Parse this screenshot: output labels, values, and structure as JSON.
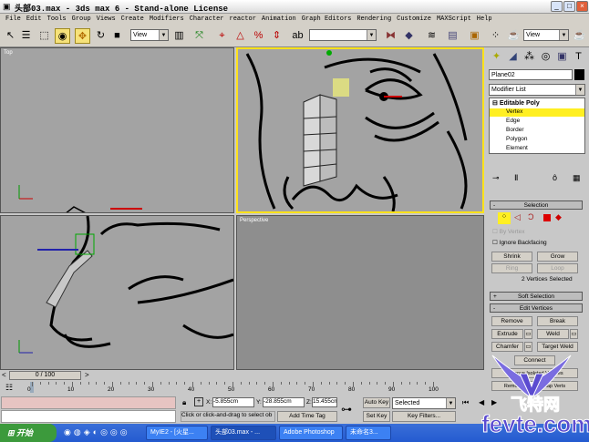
{
  "window": {
    "title": "头部03.max - 3ds max 6 - Stand-alone License",
    "min": "_",
    "max": "□",
    "close": "×"
  },
  "menu": [
    "File",
    "Edit",
    "Tools",
    "Group",
    "Views",
    "Create",
    "Modifiers",
    "Character",
    "reactor",
    "Animation",
    "Graph Editors",
    "Rendering",
    "Customize",
    "MAXScript",
    "Help"
  ],
  "toolbar": {
    "ref_coord": "View",
    "named_sel": "",
    "view2": "View"
  },
  "viewports": {
    "top": "Top",
    "front": "",
    "left": "",
    "perspective": "Perspective"
  },
  "panel": {
    "object_name": "Plane02",
    "modifier_list": "Modifier List",
    "stack": {
      "root": "Editable Poly",
      "items": [
        "Vertex",
        "Edge",
        "Border",
        "Polygon",
        "Element"
      ]
    },
    "selection": {
      "title": "Selection",
      "by_vertex": "By Vertex",
      "ignore_backfacing": "Ignore Backfacing",
      "shrink": "Shrink",
      "grow": "Grow",
      "ring": "Ring",
      "loop": "Loop",
      "status": "2 Vertices Selected"
    },
    "soft_selection": "Soft Selection",
    "edit_vertices": {
      "title": "Edit Vertices",
      "remove": "Remove",
      "break": "Break",
      "extrude": "Extrude",
      "weld": "Weld",
      "chamfer": "Chamfer",
      "target_weld": "Target Weld",
      "connect": "Connect",
      "remove_isolated": "Remove Isolated Vertices",
      "remove_unused": "Remove Unused Map Verts"
    }
  },
  "timeline": {
    "frame": "0 / 100",
    "ticks": [
      "0",
      "10",
      "20",
      "30",
      "40",
      "50",
      "60",
      "70",
      "80",
      "90",
      "100"
    ]
  },
  "status": {
    "x": "-5.855cm",
    "y": "-28.855cm",
    "z": "15.455cm",
    "prompt": "Click or click-and-drag to select ob",
    "add_time_tag": "Add Time Tag",
    "auto_key": "Auto Key",
    "set_key": "Set Key",
    "key_mode": "Selected",
    "key_filters": "Key Filters..."
  },
  "taskbar": {
    "start": "开始",
    "tasks": [
      "MyIE2 - [火星...",
      "头部03.max - ...",
      "Adobe Photoshop",
      "未命名3..."
    ]
  },
  "watermark": {
    "brand": "飞特网",
    "url": "fevte.com"
  }
}
